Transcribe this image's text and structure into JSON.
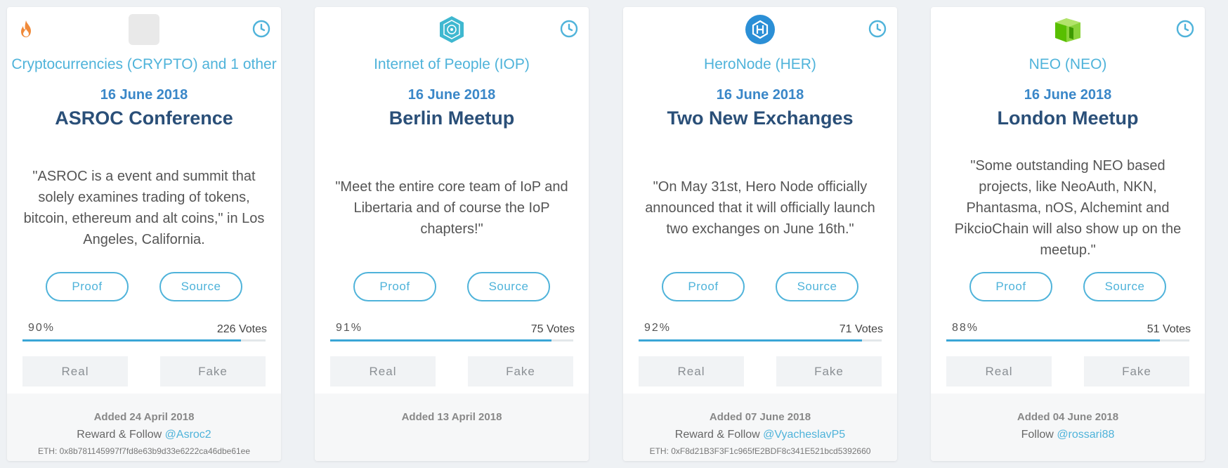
{
  "cards": [
    {
      "coin_logo": "placeholder-logo",
      "coin_name": "Cryptocurrencies (CRYPTO) and 1 other",
      "date": "16 June 2018",
      "title": "ASROC Conference",
      "quote": "\"ASROC is a event and summit that solely examines trading of tokens, bitcoin, ethereum and alt coins,\" in Los Angeles, California.",
      "proof_label": "Proof",
      "source_label": "Source",
      "percent_text": "90%",
      "percent": 0.9,
      "votes_text": "226 Votes",
      "real_label": "Real",
      "fake_label": "Fake",
      "added": "Added 24 April 2018",
      "follow_prefix": "Reward & Follow ",
      "follow_handle": "@Asroc2",
      "eth": "ETH: 0x8b781145997f7fd8e63b9d33e6222ca46dbe61ee",
      "hot": true
    },
    {
      "coin_logo": "iop-logo",
      "coin_name": "Internet of People (IOP)",
      "date": "16 June 2018",
      "title": "Berlin Meetup",
      "quote": "\"Meet the entire core team of IoP and Libertaria and of course the IoP chapters!\"",
      "proof_label": "Proof",
      "source_label": "Source",
      "percent_text": "91%",
      "percent": 0.91,
      "votes_text": "75 Votes",
      "real_label": "Real",
      "fake_label": "Fake",
      "added": "Added 13 April 2018",
      "follow_prefix": "",
      "follow_handle": "",
      "eth": "",
      "hot": false
    },
    {
      "coin_logo": "heronode-logo",
      "coin_name": "HeroNode (HER)",
      "date": "16 June 2018",
      "title": "Two New Exchanges",
      "quote": "\"On May 31st, Hero Node officially announced that it will officially launch two exchanges on June 16th.\"",
      "proof_label": "Proof",
      "source_label": "Source",
      "percent_text": "92%",
      "percent": 0.92,
      "votes_text": "71 Votes",
      "real_label": "Real",
      "fake_label": "Fake",
      "added": "Added 07 June 2018",
      "follow_prefix": "Reward & Follow ",
      "follow_handle": "@VyacheslavP5",
      "eth": "ETH: 0xF8d21B3F3F1c965fE2BDF8c341E521bcd5392660",
      "hot": false
    },
    {
      "coin_logo": "neo-logo",
      "coin_name": "NEO (NEO)",
      "date": "16 June 2018",
      "title": "London Meetup",
      "quote": "\"Some outstanding NEO based projects, like NeoAuth, NKN, Phantasma, nOS, Alchemint and PikcioChain will also show up on the meetup.\"",
      "proof_label": "Proof",
      "source_label": "Source",
      "percent_text": "88%",
      "percent": 0.88,
      "votes_text": "51 Votes",
      "real_label": "Real",
      "fake_label": "Fake",
      "added": "Added 04 June 2018",
      "follow_prefix": "Follow ",
      "follow_handle": "@rossari88",
      "eth": "",
      "hot": false
    }
  ],
  "colors": {
    "accent": "#4fb3da",
    "date": "#3a87c8",
    "title": "#2a4f78",
    "bar": "#3aa6d6"
  },
  "icons": {
    "hot": "fire-icon",
    "time": "clock-icon"
  }
}
